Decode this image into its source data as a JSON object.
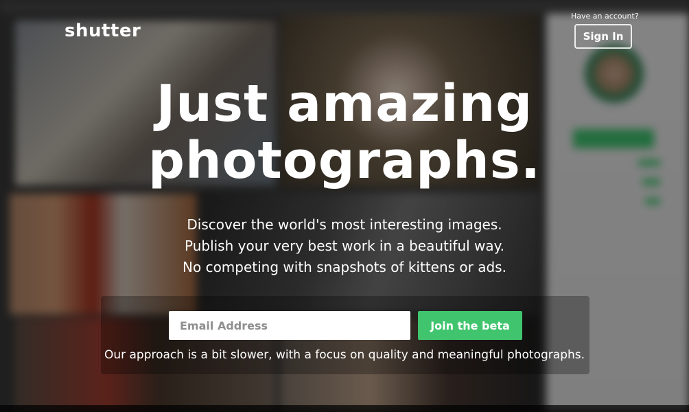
{
  "header": {
    "logo_text": "shutter",
    "have_account_text": "Have an account?",
    "sign_in_label": "Sign In"
  },
  "hero": {
    "title_line1": "Just amazing",
    "title_line2": "photographs.",
    "subtitle_line1": "Discover the world's most interesting images.",
    "subtitle_line2": "Publish your very best work in a beautiful way.",
    "subtitle_line3": "No competing with snapshots of kittens or ads."
  },
  "cta": {
    "email_placeholder": "Email Address",
    "email_value": "",
    "join_label": "Join the beta",
    "note": "Our approach is a bit slower, with a focus on quality and meaningful photographs."
  },
  "colors": {
    "accent_green": "#40c56e",
    "overlay": "rgba(0,0,0,0.45)",
    "text": "#ffffff"
  }
}
